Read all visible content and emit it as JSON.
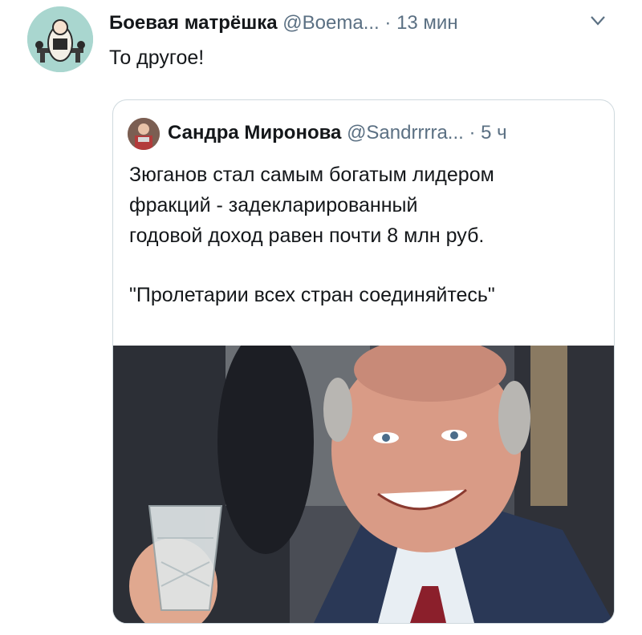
{
  "tweet": {
    "author_name": "Боевая матрёшка",
    "author_handle": "@Boema...",
    "separator": "·",
    "time": "13 мин",
    "text": "То другое!"
  },
  "quoted_tweet": {
    "author_name": "Сандра Миронова",
    "author_handle": "@Sandrrrra...",
    "separator": "·",
    "time": "5 ч",
    "line1": "Зюганов стал самым богатым лидером",
    "line2": "фракций  - задекларированный",
    "line3": "годовой доход равен почти 8 млн руб.",
    "line4": "\"Пролетарии всех стран соединяйтесь\""
  },
  "icons": {
    "avatar": "matryoshka-avatar",
    "more": "chevron-down-icon",
    "quoted_avatar": "user-avatar",
    "photo": "photo-of-smiling-man-with-glass"
  }
}
